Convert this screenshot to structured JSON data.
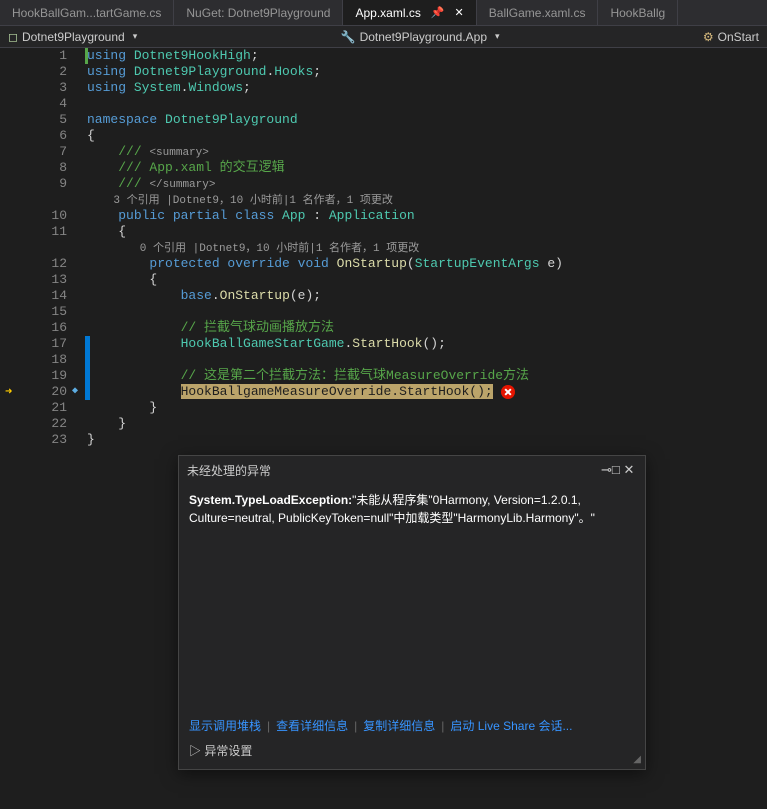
{
  "tabs": [
    {
      "label": "HookBallGam...tartGame.cs",
      "active": false,
      "hasIcon": true
    },
    {
      "label": "NuGet: Dotnet9Playground",
      "active": false,
      "hasIcon": false
    },
    {
      "label": "App.xaml.cs",
      "active": true,
      "hasIcon": true,
      "pinned": true
    },
    {
      "label": "BallGame.xaml.cs",
      "active": false,
      "hasIcon": false
    },
    {
      "label": "HookBallg",
      "active": false,
      "hasIcon": false
    }
  ],
  "breadcrumb": {
    "namespace": "Dotnet9Playground",
    "class": "Dotnet9Playground.App",
    "method": "OnStart"
  },
  "code": {
    "lines": [
      {
        "n": 1,
        "fold": "-",
        "segs": [
          {
            "t": "using ",
            "c": "kw"
          },
          {
            "t": "Dotnet9HookHigh",
            "c": "type"
          },
          {
            "t": ";",
            "c": "punct"
          }
        ]
      },
      {
        "n": 2,
        "segs": [
          {
            "t": "using ",
            "c": "kw"
          },
          {
            "t": "Dotnet9Playground",
            "c": "type"
          },
          {
            "t": ".",
            "c": "punct"
          },
          {
            "t": "Hooks",
            "c": "type"
          },
          {
            "t": ";",
            "c": "punct"
          }
        ]
      },
      {
        "n": 3,
        "segs": [
          {
            "t": "using ",
            "c": "kw"
          },
          {
            "t": "System",
            "c": "type"
          },
          {
            "t": ".",
            "c": "punct"
          },
          {
            "t": "Windows",
            "c": "type"
          },
          {
            "t": ";",
            "c": "punct"
          }
        ]
      },
      {
        "n": 4,
        "segs": []
      },
      {
        "n": 5,
        "fold": "-",
        "segs": [
          {
            "t": "namespace ",
            "c": "kw"
          },
          {
            "t": "Dotnet9Playground",
            "c": "type"
          }
        ]
      },
      {
        "n": 6,
        "segs": [
          {
            "t": "{",
            "c": "brace"
          }
        ]
      },
      {
        "n": 7,
        "fold": "-",
        "segs": [
          {
            "t": "    ",
            "c": ""
          },
          {
            "t": "/// ",
            "c": "comment"
          },
          {
            "t": "<summary>",
            "c": "meta"
          }
        ]
      },
      {
        "n": 8,
        "segs": [
          {
            "t": "    ",
            "c": ""
          },
          {
            "t": "/// App.xaml 的交互逻辑",
            "c": "comment"
          }
        ]
      },
      {
        "n": 9,
        "segs": [
          {
            "t": "    ",
            "c": ""
          },
          {
            "t": "/// ",
            "c": "comment"
          },
          {
            "t": "</summary>",
            "c": "meta"
          }
        ]
      },
      {
        "n": "",
        "segs": [
          {
            "t": "    3 个引用 |Dotnet9，10 小时前|1 名作者，1 项更改",
            "c": "meta"
          }
        ]
      },
      {
        "n": 10,
        "fold": "-",
        "segs": [
          {
            "t": "    ",
            "c": ""
          },
          {
            "t": "public partial class ",
            "c": "kw"
          },
          {
            "t": "App",
            "c": "type"
          },
          {
            "t": " : ",
            "c": "punct"
          },
          {
            "t": "Application",
            "c": "type"
          }
        ]
      },
      {
        "n": 11,
        "segs": [
          {
            "t": "    {",
            "c": "brace"
          }
        ]
      },
      {
        "n": "",
        "segs": [
          {
            "t": "        0 个引用 |Dotnet9，10 小时前|1 名作者，1 项更改",
            "c": "meta"
          }
        ]
      },
      {
        "n": 12,
        "fold": "-",
        "segs": [
          {
            "t": "        ",
            "c": ""
          },
          {
            "t": "protected override void ",
            "c": "kw"
          },
          {
            "t": "OnStartup",
            "c": "method"
          },
          {
            "t": "(",
            "c": "punct"
          },
          {
            "t": "StartupEventArgs",
            "c": "type"
          },
          {
            "t": " e)",
            "c": "punct"
          }
        ]
      },
      {
        "n": 13,
        "segs": [
          {
            "t": "        {",
            "c": "brace"
          }
        ]
      },
      {
        "n": 14,
        "segs": [
          {
            "t": "            ",
            "c": ""
          },
          {
            "t": "base",
            "c": "kw"
          },
          {
            "t": ".",
            "c": "punct"
          },
          {
            "t": "OnStartup",
            "c": "method"
          },
          {
            "t": "(e);",
            "c": "punct"
          }
        ]
      },
      {
        "n": 15,
        "segs": []
      },
      {
        "n": 16,
        "segs": [
          {
            "t": "            ",
            "c": ""
          },
          {
            "t": "// 拦截气球动画播放方法",
            "c": "comment"
          }
        ]
      },
      {
        "n": 17,
        "change": true,
        "segs": [
          {
            "t": "            ",
            "c": ""
          },
          {
            "t": "HookBallGameStartGame",
            "c": "type"
          },
          {
            "t": ".",
            "c": "punct"
          },
          {
            "t": "StartHook",
            "c": "method"
          },
          {
            "t": "();",
            "c": "punct"
          }
        ]
      },
      {
        "n": 18,
        "change": true,
        "segs": []
      },
      {
        "n": 19,
        "change": true,
        "segs": [
          {
            "t": "            ",
            "c": ""
          },
          {
            "t": "// 这是第二个拦截方法：拦截气球MeasureOverride方法",
            "c": "comment"
          }
        ]
      },
      {
        "n": 20,
        "change": true,
        "current": true,
        "highlight": true,
        "segs": [
          {
            "t": "            ",
            "c": ""
          },
          {
            "t": "HookBallgameMeasureOverride",
            "c": "hl-type"
          },
          {
            "t": ".",
            "c": "hl-punct"
          },
          {
            "t": "StartHook",
            "c": "hl-method"
          },
          {
            "t": "();",
            "c": "hl-punct"
          }
        ],
        "stopIcon": true
      },
      {
        "n": 21,
        "segs": [
          {
            "t": "        }",
            "c": "brace"
          }
        ]
      },
      {
        "n": 22,
        "segs": [
          {
            "t": "    }",
            "c": "brace"
          }
        ]
      },
      {
        "n": 23,
        "segs": [
          {
            "t": "}",
            "c": "brace"
          }
        ]
      }
    ]
  },
  "exception": {
    "title": "未经处理的异常",
    "type": "System.TypeLoadException:",
    "message": "\"未能从程序集\"0Harmony, Version=1.2.0.1, Culture=neutral, PublicKeyToken=null\"中加载类型\"HarmonyLib.Harmony\"。\"",
    "links": {
      "callstack": "显示调用堆栈",
      "details": "查看详细信息",
      "copy": "复制详细信息",
      "liveshare": "启动 Live Share 会话..."
    },
    "settings": "异常设置"
  }
}
